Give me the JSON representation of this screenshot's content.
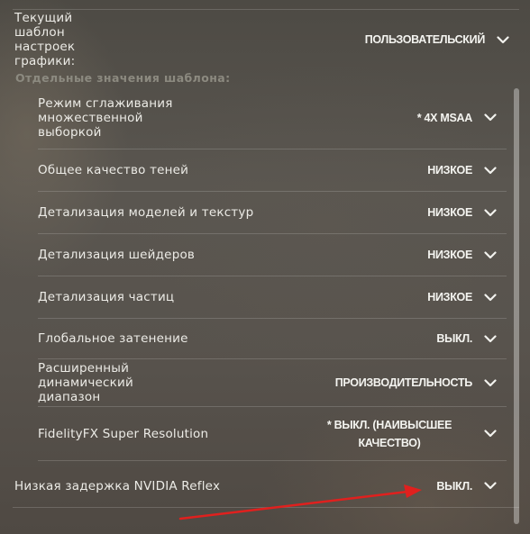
{
  "preset": {
    "label": "Текущий шаблон настроек графики:",
    "value": "ПОЛЬЗОВАТЕЛЬСКИЙ"
  },
  "section_title": "Отдельные значения шаблона:",
  "settings": [
    {
      "label": "Режим сглаживания множественной выборкой",
      "value": "* 4X MSAA"
    },
    {
      "label": "Общее качество теней",
      "value": "НИЗКОЕ"
    },
    {
      "label": "Детализация моделей и текстур",
      "value": "НИЗКОЕ"
    },
    {
      "label": "Детализация шейдеров",
      "value": "НИЗКОЕ"
    },
    {
      "label": "Детализация частиц",
      "value": "НИЗКОЕ"
    },
    {
      "label": "Глобальное затенение",
      "value": "ВЫКЛ."
    },
    {
      "label": "Расширенный динамический диапазон",
      "value": "ПРОИЗВОДИТЕЛЬНОСТЬ"
    },
    {
      "label": "FidelityFX Super Resolution",
      "value": "* ВЫКЛ. (НАИВЫСШЕЕ КАЧЕСТВО)"
    }
  ],
  "reflex": {
    "label": "Низкая задержка NVIDIA Reflex",
    "value": "ВЫКЛ."
  },
  "icons": {
    "chevron": "chevron-down-icon",
    "annotation": "red-arrow-icon"
  },
  "colors": {
    "arrow": "#e0201e",
    "section_title": "#8c8a80"
  }
}
